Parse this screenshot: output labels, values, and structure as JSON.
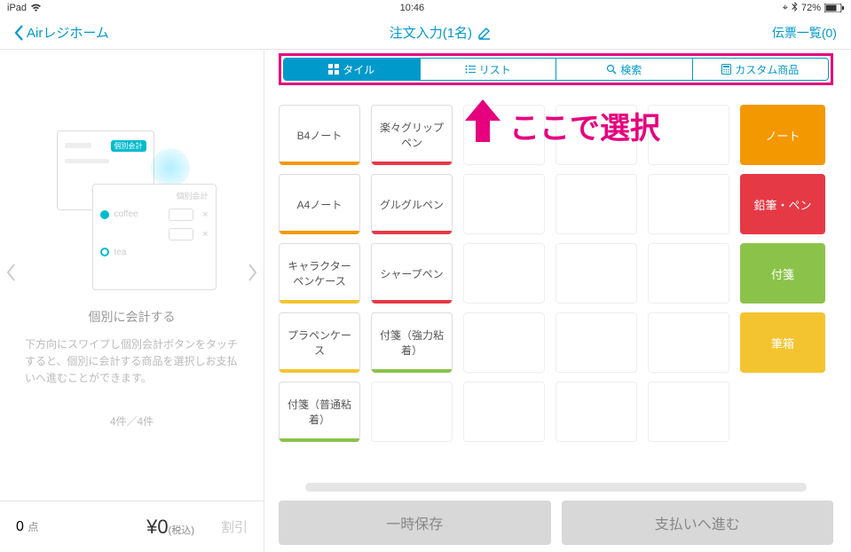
{
  "status": {
    "device": "iPad",
    "time": "10:46",
    "battery": "72%"
  },
  "nav": {
    "back": "Airレジホーム",
    "title": "注文入力(1名)",
    "right": "伝票一覧(0)"
  },
  "tabs": [
    {
      "label": "タイル",
      "icon": "grid"
    },
    {
      "label": "リスト",
      "icon": "list"
    },
    {
      "label": "検索",
      "icon": "search"
    },
    {
      "label": "カスタム商品",
      "icon": "calc"
    }
  ],
  "callout": "ここで選択",
  "help": {
    "badge": "個別会計",
    "card_lines": [
      "個別会計",
      "coffee",
      "tea"
    ],
    "title": "個別に会計する",
    "desc": "下方向にスワイプし個別会計ボタンをタッチすると、個別に会計する商品を選択しお支払いへ進むことができます。",
    "counter": "4件／4件"
  },
  "products": [
    [
      {
        "label": "B4ノート",
        "accent": "orange"
      },
      {
        "label": "楽々グリップペン",
        "accent": "red"
      },
      null,
      null,
      null,
      {
        "cat": "ノート",
        "color": "orange"
      }
    ],
    [
      {
        "label": "A4ノート",
        "accent": "orange"
      },
      {
        "label": "グルグルペン",
        "accent": "red"
      },
      null,
      null,
      null,
      {
        "cat": "鉛筆・ペン",
        "color": "red"
      }
    ],
    [
      {
        "label": "キャラクターペンケース",
        "accent": "yellow"
      },
      {
        "label": "シャープペン",
        "accent": "red"
      },
      null,
      null,
      null,
      {
        "cat": "付箋",
        "color": "green"
      }
    ],
    [
      {
        "label": "プラペンケース",
        "accent": "yellow"
      },
      {
        "label": "付箋（強力粘着）",
        "accent": "green"
      },
      null,
      null,
      null,
      {
        "cat": "筆箱",
        "color": "yellow"
      }
    ],
    [
      {
        "label": "付箋（普通粘着）",
        "accent": "green"
      },
      null,
      null,
      null,
      null,
      null
    ]
  ],
  "cart": {
    "count": "0",
    "count_unit": "点",
    "total": "¥0",
    "tax_label": "(税込)",
    "discount": "割引"
  },
  "buttons": {
    "save": "一時保存",
    "pay": "支払いへ進む"
  }
}
